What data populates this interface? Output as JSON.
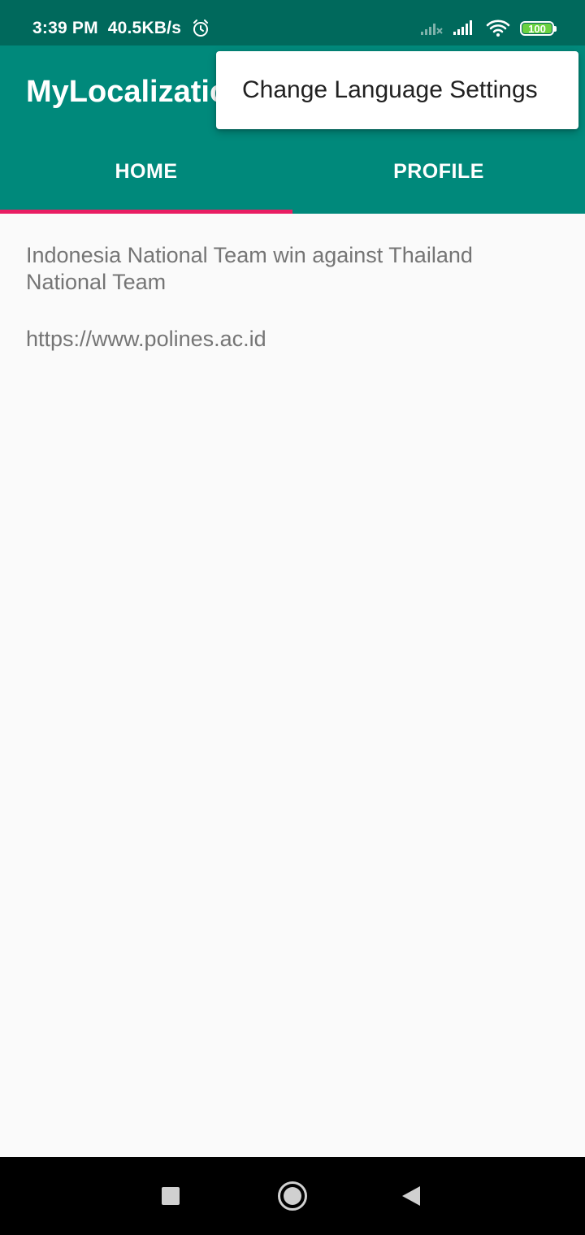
{
  "status_bar": {
    "time": "3:39 PM",
    "net_speed": "40.5KB/s",
    "battery_level": "100",
    "icons": [
      "alarm-icon",
      "signal-off-icon",
      "signal-icon",
      "wifi-icon",
      "battery-icon"
    ]
  },
  "app_bar": {
    "title": "MyLocalization",
    "tabs": [
      {
        "label": "HOME",
        "selected": true
      },
      {
        "label": "PROFILE",
        "selected": false
      }
    ]
  },
  "overflow_menu": {
    "items": [
      {
        "label": "Change Language Settings"
      }
    ]
  },
  "content": {
    "headline": "Indonesia National Team win against Thailand National Team",
    "link": "https://www.polines.ac.id"
  },
  "nav_bar": {
    "buttons": [
      "recents-icon",
      "home-icon",
      "back-icon"
    ]
  },
  "colors": {
    "status_bar": "#00695c",
    "app_bar": "#00897b",
    "tab_indicator": "#e91e63",
    "content_text": "#757575",
    "background": "#fafafa"
  }
}
